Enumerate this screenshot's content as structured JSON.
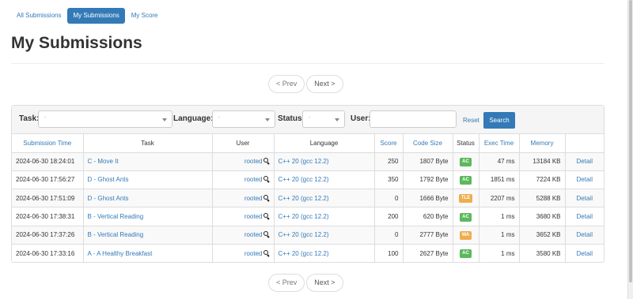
{
  "tabs": [
    {
      "label": "All Submissions",
      "active": false
    },
    {
      "label": "My Submissions",
      "active": true
    },
    {
      "label": "My Score",
      "active": false
    }
  ],
  "page_title": "My Submissions",
  "pager": {
    "prev": "< Prev",
    "next": "Next >"
  },
  "filter": {
    "task_label": "Task:",
    "task_value": "-",
    "language_label": "Language:",
    "language_value": "-",
    "status_label": "Status:",
    "status_value": "-",
    "user_label": "User:",
    "user_value": "",
    "reset": "Reset",
    "search": "Search"
  },
  "columns": [
    "Submission Time",
    "Task",
    "User",
    "Language",
    "Score",
    "Code Size",
    "Status",
    "Exec Time",
    "Memory",
    ""
  ],
  "status_colors": {
    "AC": "#5cb85c",
    "TLE": "#f0ad4e",
    "WA": "#f0ad4e"
  },
  "rows": [
    {
      "time": "2024-06-30 18:24:01",
      "task": "C - Move It",
      "user": "rooted",
      "language": "C++ 20 (gcc 12.2)",
      "score": "250",
      "code_size": "1807 Byte",
      "status": "AC",
      "exec_time": "47 ms",
      "memory": "13184 KB",
      "detail": "Detail"
    },
    {
      "time": "2024-06-30 17:56:27",
      "task": "D - Ghost Ants",
      "user": "rooted",
      "language": "C++ 20 (gcc 12.2)",
      "score": "350",
      "code_size": "1792 Byte",
      "status": "AC",
      "exec_time": "1851 ms",
      "memory": "7224 KB",
      "detail": "Detail"
    },
    {
      "time": "2024-06-30 17:51:09",
      "task": "D - Ghost Ants",
      "user": "rooted",
      "language": "C++ 20 (gcc 12.2)",
      "score": "0",
      "code_size": "1666 Byte",
      "status": "TLE",
      "exec_time": "2207 ms",
      "memory": "5288 KB",
      "detail": "Detail"
    },
    {
      "time": "2024-06-30 17:38:31",
      "task": "B - Vertical Reading",
      "user": "rooted",
      "language": "C++ 20 (gcc 12.2)",
      "score": "200",
      "code_size": "620 Byte",
      "status": "AC",
      "exec_time": "1 ms",
      "memory": "3680 KB",
      "detail": "Detail"
    },
    {
      "time": "2024-06-30 17:37:26",
      "task": "B - Vertical Reading",
      "user": "rooted",
      "language": "C++ 20 (gcc 12.2)",
      "score": "0",
      "code_size": "2777 Byte",
      "status": "WA",
      "exec_time": "1 ms",
      "memory": "3652 KB",
      "detail": "Detail"
    },
    {
      "time": "2024-06-30 17:33:16",
      "task": "A - A Healthy Breakfast",
      "user": "rooted",
      "language": "C++ 20 (gcc 12.2)",
      "score": "100",
      "code_size": "2627 Byte",
      "status": "AC",
      "exec_time": "1 ms",
      "memory": "3580 KB",
      "detail": "Detail"
    }
  ]
}
